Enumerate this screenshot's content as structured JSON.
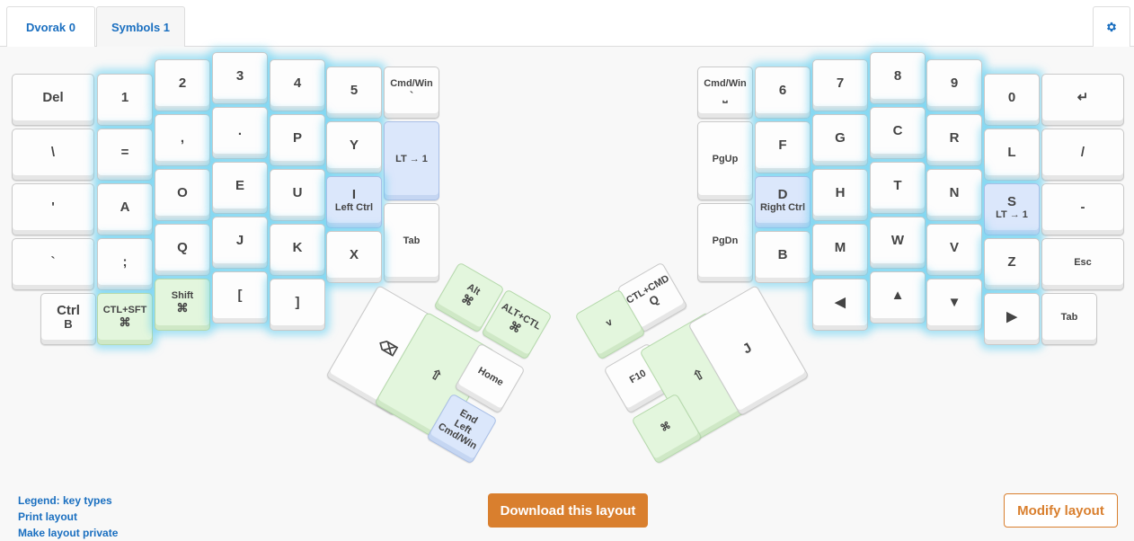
{
  "tabs": [
    {
      "label": "Dvorak 0",
      "active": true
    },
    {
      "label": "Symbols 1",
      "active": false
    }
  ],
  "settings_icon": "gear-icon",
  "colors": {
    "accent": "#1a6fc0",
    "button_orange": "#d97f2e",
    "key_green": "#e3f6dd",
    "key_blue": "#dbe7fb",
    "glow": "#5fcdf0"
  },
  "keys": [
    {
      "id": "l-del",
      "label": "Del",
      "color": "white"
    },
    {
      "id": "l-1",
      "label": "1",
      "color": "white"
    },
    {
      "id": "l-2",
      "label": "2",
      "color": "white"
    },
    {
      "id": "l-3",
      "label": "3",
      "color": "white"
    },
    {
      "id": "l-4",
      "label": "4",
      "color": "white"
    },
    {
      "id": "l-5",
      "label": "5",
      "color": "white"
    },
    {
      "id": "l-cmdwin",
      "label": "Cmd/Win",
      "sub": "`",
      "color": "white"
    },
    {
      "id": "l-backslash",
      "label": "\\",
      "color": "white"
    },
    {
      "id": "l-equals",
      "label": "=",
      "color": "white"
    },
    {
      "id": "l-comma",
      "label": ",",
      "color": "white"
    },
    {
      "id": "l-period",
      "label": ".",
      "color": "white"
    },
    {
      "id": "l-p",
      "label": "P",
      "color": "white"
    },
    {
      "id": "l-y",
      "label": "Y",
      "color": "white"
    },
    {
      "id": "l-lt1",
      "label": "LT → 1",
      "color": "blue"
    },
    {
      "id": "l-quote",
      "label": "'",
      "color": "white"
    },
    {
      "id": "l-a",
      "label": "A",
      "color": "white"
    },
    {
      "id": "l-o",
      "label": "O",
      "color": "white"
    },
    {
      "id": "l-e",
      "label": "E",
      "color": "white"
    },
    {
      "id": "l-u",
      "label": "U",
      "color": "white"
    },
    {
      "id": "l-i",
      "label": "I",
      "sub": "Left Ctrl",
      "color": "blue"
    },
    {
      "id": "l-tab",
      "label": "Tab",
      "color": "white"
    },
    {
      "id": "l-grave",
      "label": "`",
      "color": "white"
    },
    {
      "id": "l-semicolon",
      "label": ";",
      "color": "white"
    },
    {
      "id": "l-q",
      "label": "Q",
      "color": "white"
    },
    {
      "id": "l-j",
      "label": "J",
      "color": "white"
    },
    {
      "id": "l-k",
      "label": "K",
      "color": "white"
    },
    {
      "id": "l-x",
      "label": "X",
      "color": "white"
    },
    {
      "id": "l-ctrlb",
      "label": "Ctrl",
      "sub": "B",
      "color": "white"
    },
    {
      "id": "l-ctlsft",
      "label": "CTL+SFT",
      "sub": "⌘",
      "color": "green"
    },
    {
      "id": "l-shift",
      "label": "Shift",
      "sub": "⌘",
      "color": "green"
    },
    {
      "id": "l-lbracket",
      "label": "[",
      "color": "white"
    },
    {
      "id": "l-rbracket",
      "label": "]",
      "color": "white"
    },
    {
      "id": "lt-backspace",
      "label": "⌫",
      "color": "white"
    },
    {
      "id": "lt-shift",
      "label": "⇧",
      "color": "green"
    },
    {
      "id": "lt-alt",
      "label": "Alt",
      "sub": "⌘",
      "color": "green"
    },
    {
      "id": "lt-altctl",
      "label": "ALT+CTL",
      "sub": "⌘",
      "color": "green"
    },
    {
      "id": "lt-home",
      "label": "Home",
      "color": "white"
    },
    {
      "id": "lt-end",
      "label": "End",
      "sub": "Left Cmd/Win",
      "color": "blue"
    },
    {
      "id": "r-cmdwin",
      "label": "Cmd/Win",
      "sub": "⎵",
      "color": "white"
    },
    {
      "id": "r-6",
      "label": "6",
      "color": "white"
    },
    {
      "id": "r-7",
      "label": "7",
      "color": "white"
    },
    {
      "id": "r-8",
      "label": "8",
      "color": "white"
    },
    {
      "id": "r-9",
      "label": "9",
      "color": "white"
    },
    {
      "id": "r-0",
      "label": "0",
      "color": "white"
    },
    {
      "id": "r-enter",
      "label": "↵",
      "color": "white"
    },
    {
      "id": "r-pgup",
      "label": "PgUp",
      "color": "white"
    },
    {
      "id": "r-f",
      "label": "F",
      "color": "white"
    },
    {
      "id": "r-g",
      "label": "G",
      "color": "white"
    },
    {
      "id": "r-c",
      "label": "C",
      "color": "white"
    },
    {
      "id": "r-r",
      "label": "R",
      "color": "white"
    },
    {
      "id": "r-l",
      "label": "L",
      "color": "white"
    },
    {
      "id": "r-slash",
      "label": "/",
      "color": "white"
    },
    {
      "id": "r-pgdn",
      "label": "PgDn",
      "color": "white"
    },
    {
      "id": "r-d",
      "label": "D",
      "sub": "Right Ctrl",
      "color": "blue"
    },
    {
      "id": "r-h",
      "label": "H",
      "color": "white"
    },
    {
      "id": "r-t",
      "label": "T",
      "color": "white"
    },
    {
      "id": "r-n",
      "label": "N",
      "color": "white"
    },
    {
      "id": "r-s",
      "label": "S",
      "sub": "LT → 1",
      "color": "blue"
    },
    {
      "id": "r-minus",
      "label": "-",
      "color": "white"
    },
    {
      "id": "r-b",
      "label": "B",
      "color": "white"
    },
    {
      "id": "r-m",
      "label": "M",
      "color": "white"
    },
    {
      "id": "r-w",
      "label": "W",
      "color": "white"
    },
    {
      "id": "r-v",
      "label": "V",
      "color": "white"
    },
    {
      "id": "r-z",
      "label": "Z",
      "color": "white"
    },
    {
      "id": "r-esc",
      "label": "Esc",
      "color": "white"
    },
    {
      "id": "r-left",
      "label": "◀",
      "color": "white"
    },
    {
      "id": "r-up",
      "label": "▲",
      "color": "white"
    },
    {
      "id": "r-down",
      "label": "▼",
      "color": "white"
    },
    {
      "id": "r-right",
      "label": "▶",
      "color": "white"
    },
    {
      "id": "r-tab",
      "label": "Tab",
      "color": "white"
    },
    {
      "id": "rt-ctlcmd",
      "label": "CTL+CMD",
      "sub": "Q",
      "color": "white"
    },
    {
      "id": "rt-v",
      "label": "v",
      "color": "green"
    },
    {
      "id": "rt-f10",
      "label": "F10",
      "color": "white"
    },
    {
      "id": "rt-shift",
      "label": "⇧",
      "color": "green"
    },
    {
      "id": "rt-cmd",
      "label": "⌘",
      "color": "green"
    },
    {
      "id": "rt-j",
      "label": "J",
      "color": "white"
    }
  ],
  "legend": {
    "key_types": "Legend: key types",
    "print": "Print layout",
    "private": "Make layout private"
  },
  "download_label": "Download this layout",
  "modify_label": "Modify layout"
}
